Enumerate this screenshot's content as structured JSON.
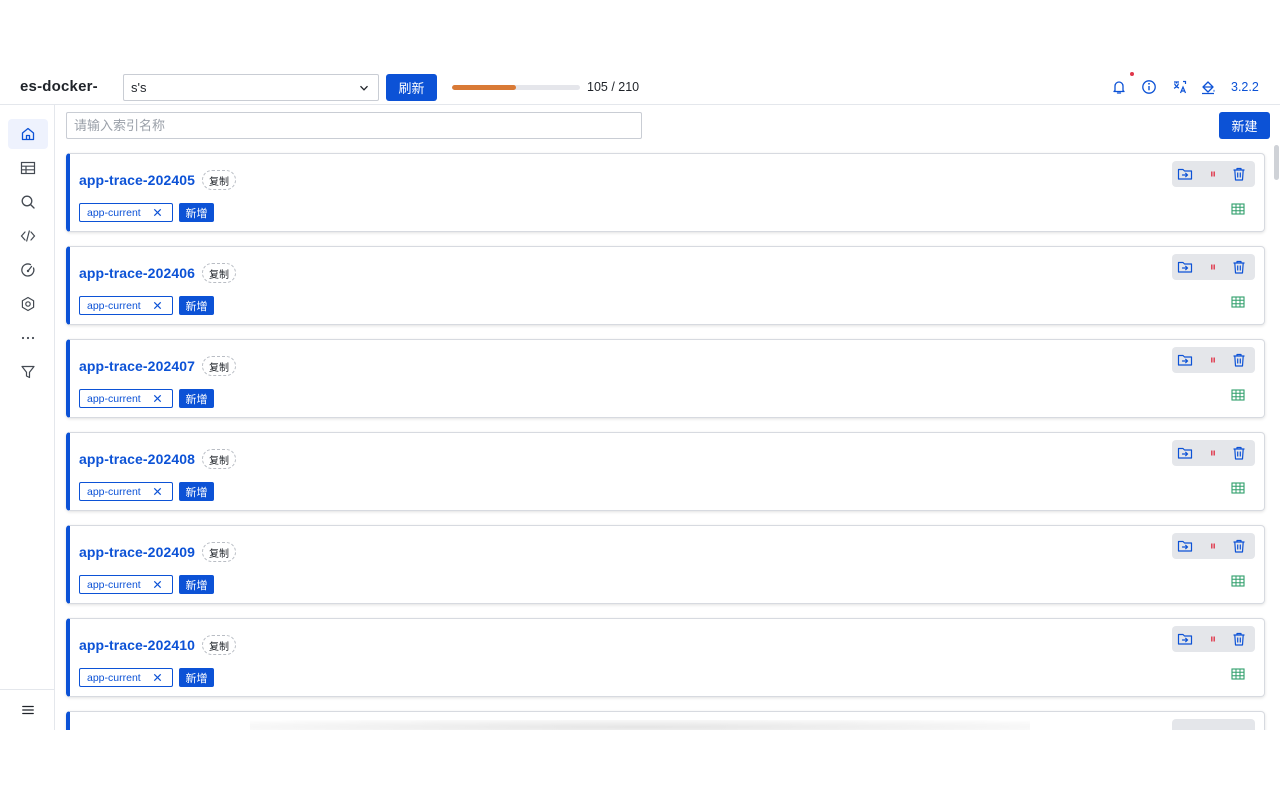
{
  "app": {
    "title": "es-docker-",
    "version": "3.2.2"
  },
  "toolbar": {
    "cluster_value": "s's",
    "refresh_label": "刷新",
    "progress": {
      "current": 105,
      "total": 210,
      "text": "105 / 210",
      "color": "#d97a36"
    }
  },
  "top_icons": [
    "bell-icon",
    "info-icon",
    "translate-icon",
    "theme-bucket-icon"
  ],
  "sidebar": {
    "items": [
      {
        "name": "home-icon",
        "active": true
      },
      {
        "name": "table-icon",
        "active": false
      },
      {
        "name": "search-icon",
        "active": false
      },
      {
        "name": "code-icon",
        "active": false
      },
      {
        "name": "gauge-icon",
        "active": false
      },
      {
        "name": "settings-hexagon-icon",
        "active": false
      },
      {
        "name": "more-dots-icon",
        "active": false
      },
      {
        "name": "filter-icon",
        "active": false
      }
    ],
    "bottom": "menu-icon"
  },
  "main": {
    "search_placeholder": "请输入索引名称",
    "new_label": "新建",
    "copy_label": "复制",
    "add_alias_label": "新增",
    "indices": [
      {
        "name": "app-trace-202405",
        "alias": "app-current"
      },
      {
        "name": "app-trace-202406",
        "alias": "app-current"
      },
      {
        "name": "app-trace-202407",
        "alias": "app-current"
      },
      {
        "name": "app-trace-202408",
        "alias": "app-current"
      },
      {
        "name": "app-trace-202409",
        "alias": "app-current"
      },
      {
        "name": "app-trace-202410",
        "alias": "app-current"
      }
    ]
  },
  "colors": {
    "primary": "#0c52d6",
    "danger": "#e0364a",
    "success": "#2e9e6a",
    "progress": "#d97a36"
  }
}
